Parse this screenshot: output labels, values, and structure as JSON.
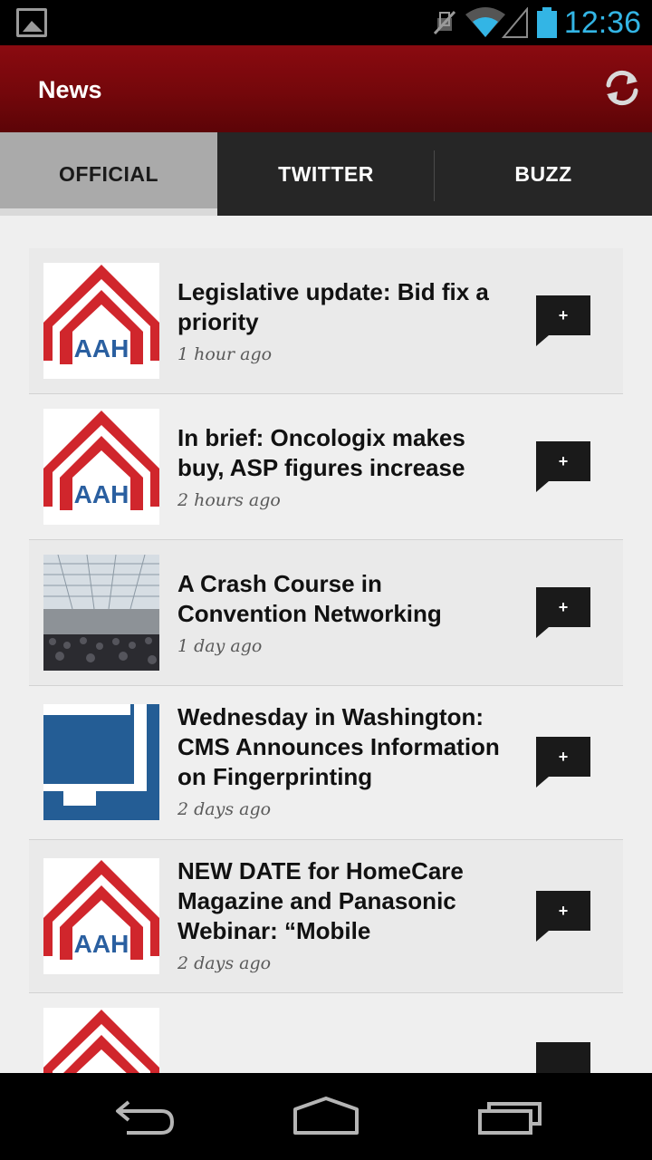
{
  "status_bar": {
    "time": "12:36",
    "icons": [
      "image-notification-icon",
      "mute-icon",
      "wifi-icon",
      "signal-icon",
      "battery-icon"
    ],
    "time_color": "#33b5e5"
  },
  "app_bar": {
    "title": "News",
    "action_icon": "refresh-icon",
    "color": "#74070b"
  },
  "tabs": [
    {
      "label": "OFFICIAL",
      "active": true
    },
    {
      "label": "TWITTER",
      "active": false
    },
    {
      "label": "BUZZ",
      "active": false
    }
  ],
  "news": [
    {
      "title": "Legislative update: Bid fix a priority",
      "time": "1 hour ago",
      "thumb": "aah-logo"
    },
    {
      "title": "In brief: Oncologix makes buy, ASP figures increase",
      "time": "2 hours ago",
      "thumb": "aah-logo"
    },
    {
      "title": "A Crash Course in Convention Networking",
      "time": "1 day ago",
      "thumb": "convention-hall-photo"
    },
    {
      "title": "Wednesday in Washington: CMS Announces Information on Fingerprinting",
      "time": "2 days ago",
      "thumb": "blue-monitor-graphic"
    },
    {
      "title": "NEW DATE for HomeCare Magazine and Panasonic Webinar: “Mobile",
      "time": "2 days ago",
      "thumb": "aah-logo"
    },
    {
      "title": "",
      "time": "",
      "thumb": "aah-logo"
    }
  ],
  "add_button_label": "+",
  "nav_bar": {
    "icons": [
      "back-icon",
      "home-icon",
      "recent-apps-icon"
    ]
  }
}
